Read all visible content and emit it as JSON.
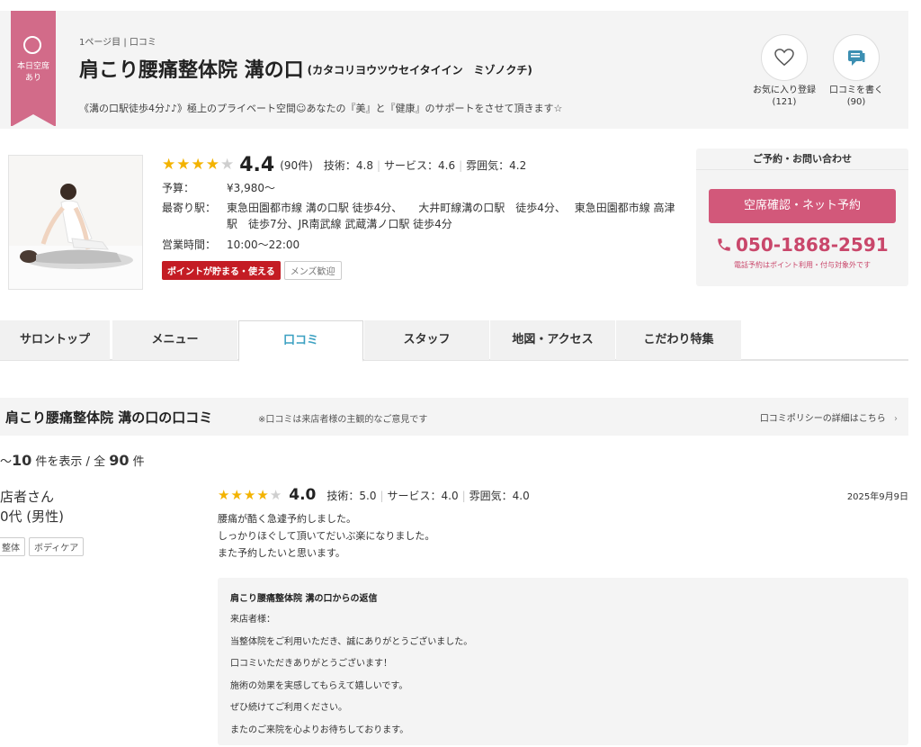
{
  "header": {
    "vacancy_badge": "本日空席\nあり",
    "breadcrumb": "1ページ目 | 口コミ",
    "title": "肩こり腰痛整体院 溝の口",
    "title_kana": "(カタコリヨウツウセイタイイン　ミゾノクチ)",
    "catch_copy": "《溝の口駅徒歩4分♪♪》極上のプライベート空間☺あなたの『美』と『健康』のサポートをさせて頂きます☆",
    "favorite_label": "お気に入り登録",
    "favorite_count": "(121)",
    "write_review_label": "口コミを書く",
    "write_review_count": "(90)"
  },
  "summary": {
    "rating": "4.4",
    "rating_stars": 4,
    "review_count": "(90件)",
    "technique": "技術：4.8",
    "service": "サービス：4.6",
    "atmosphere": "雰囲気：4.2",
    "budget_label": "予算：",
    "budget_value": "¥3,980〜",
    "station_label": "最寄り駅：",
    "station_value": "東急田園都市線 溝の口駅 徒歩4分、　　大井町線溝の口駅　徒歩4分、　 東急田園都市線 高津駅　徒歩7分、JR南武線 武蔵溝ノ口駅 徒歩4分",
    "hours_label": "営業時間：",
    "hours_value": "10:00〜22:00",
    "badge_point": "ポイントが貯まる・使える",
    "badge_men": "メンズ歓迎"
  },
  "reserve": {
    "heading": "ご予約・お問い合わせ",
    "button": "空席確認・ネット予約",
    "phone": "050-1868-2591",
    "phone_note": "電話予約はポイント利用・付与対象外です"
  },
  "tabs": [
    {
      "label": "サロントップ"
    },
    {
      "label": "メニュー"
    },
    {
      "label": "口コミ"
    },
    {
      "label": "スタッフ"
    },
    {
      "label": "地図・アクセス"
    },
    {
      "label": "こだわり特集"
    }
  ],
  "reviews_section": {
    "title": "肩こり腰痛整体院 溝の口の口コミ",
    "note": "※口コミは来店者様の主観的なご意見です",
    "policy_link": "口コミポリシーの詳細はこちら",
    "count_prefix": "〜",
    "count_shown": "10",
    "count_mid": "件を表示 / 全",
    "count_total": "90",
    "count_suffix": "件"
  },
  "review": {
    "reviewer_name": "店者さん",
    "reviewer_age": "0代 (男性)",
    "tags": [
      "整体",
      "ボディケア"
    ],
    "rating": "4.0",
    "rating_stars": 4,
    "technique": "技術：5.0",
    "service": "サービス：4.0",
    "atmosphere": "雰囲気：4.0",
    "date": "2025年9月9日",
    "body": [
      "腰痛が酷く急遽予約しました。",
      "しっかりほぐして頂いてだいぶ楽になりました。",
      "また予約したいと思います。"
    ],
    "reply_title": "肩こり腰痛整体院 溝の口からの返信",
    "reply_body": [
      "来店者様：",
      "当整体院をご利用いただき、誠にありがとうございました。",
      "口コミいただきありがとうございます！",
      "施術の効果を実感してもらえて嬉しいです。",
      "ぜひ続けてご利用ください。",
      "またのご来院を心よりお待ちしております。"
    ]
  },
  "colors": {
    "accent_pink": "#d2587a",
    "tab_active": "#3ca1c2",
    "star": "#f3b300"
  }
}
